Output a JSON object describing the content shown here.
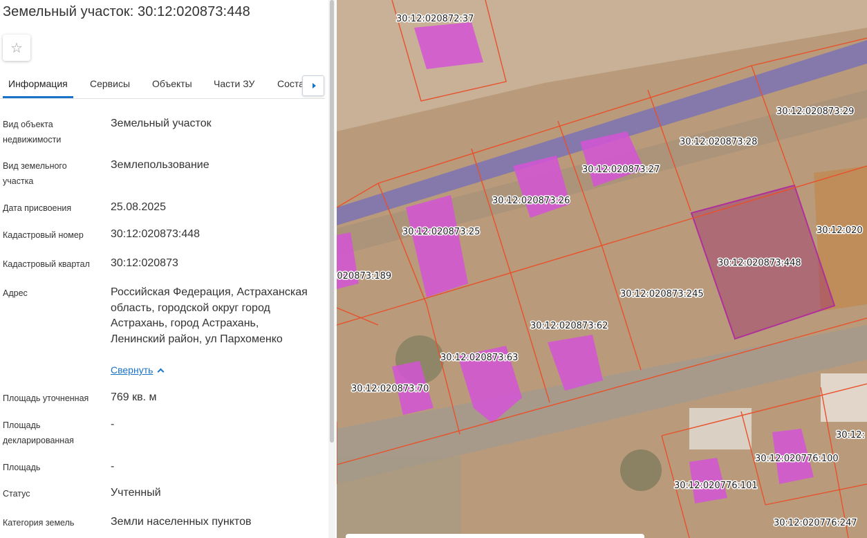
{
  "header": {
    "title": "Земельный участок: 30:12:020873:448",
    "favorite_icon": "star-outline-icon"
  },
  "tabs": [
    {
      "label": "Информация",
      "active": true
    },
    {
      "label": "Сервисы",
      "active": false
    },
    {
      "label": "Объекты",
      "active": false
    },
    {
      "label": "Части ЗУ",
      "active": false
    },
    {
      "label": "Состав ЗУ",
      "active": false
    }
  ],
  "tabs_next_icon": "caret-right-icon",
  "info": {
    "object_type_label": "Вид объекта недвижимости",
    "object_type_value": "Земельный участок",
    "land_type_label": "Вид земельного участка",
    "land_type_value": "Землепользование",
    "date_label": "Дата присвоения",
    "date_value": "25.08.2025",
    "cadastral_number_label": "Кадастровый номер",
    "cadastral_number_value": "30:12:020873:448",
    "cadastral_quarter_label": "Кадастровый квартал",
    "cadastral_quarter_value": "30:12:020873",
    "address_label": "Адрес",
    "address_value": "Российская Федерация, Астраханская область, городской округ город Астрахань, город Астрахань, Ленинский район, ул Пархоменко",
    "collapse_label": "Свернуть",
    "area_specified_label": "Площадь уточненная",
    "area_specified_value": "769 кв. м",
    "area_declared_label": "Площадь декларированная",
    "area_declared_value": "-",
    "area_label": "Площадь",
    "area_value": "-",
    "status_label": "Статус",
    "status_value": "Учтенный",
    "category_label": "Категория земель",
    "category_value": "Земли населенных пунктов"
  },
  "map": {
    "parcel_labels": [
      "30:12:020872:37",
      "30:12:020873:29",
      "30:12:020873:28",
      "30:12:020873:27",
      "30:12:020873:26",
      "30:12:020873:25",
      "30:12:020",
      ":020873:189",
      "30:12:020873:448",
      "30:12:020873:245",
      "30:12:020873:62",
      "30:12:020873:63",
      "30:12:020873:70",
      "30:12:020776:100",
      "30:12:020776:101",
      "30:12:020776:247",
      "30:12:"
    ],
    "colors": {
      "boundary": "#e8502a",
      "building": "#d64fd6",
      "selected": "#b0309a",
      "road_band": "#5a5ac8",
      "accent": "#1a73c8"
    }
  }
}
